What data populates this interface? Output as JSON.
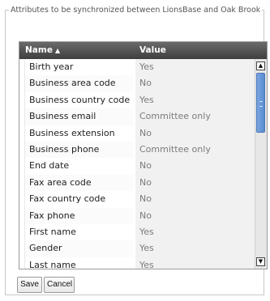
{
  "legend": "Attributes to be synchronized between LionsBase and Oak Brook",
  "grid": {
    "columns": {
      "name": "Name",
      "sort_indicator": "▲",
      "value": "Value"
    },
    "rows": [
      {
        "name": "Birth year",
        "value": "Yes"
      },
      {
        "name": "Business area code",
        "value": "No"
      },
      {
        "name": "Business country code",
        "value": "Yes"
      },
      {
        "name": "Business email",
        "value": "Committee only"
      },
      {
        "name": "Business extension",
        "value": "No"
      },
      {
        "name": "Business phone",
        "value": "Committee only"
      },
      {
        "name": "End date",
        "value": "No"
      },
      {
        "name": "Fax area code",
        "value": "No"
      },
      {
        "name": "Fax country code",
        "value": "No"
      },
      {
        "name": "Fax phone",
        "value": "No"
      },
      {
        "name": "First name",
        "value": "Yes"
      },
      {
        "name": "Gender",
        "value": "Yes"
      },
      {
        "name": "Last name",
        "value": "Yes"
      }
    ]
  },
  "buttons": {
    "save": "Save",
    "cancel": "Cancel"
  }
}
